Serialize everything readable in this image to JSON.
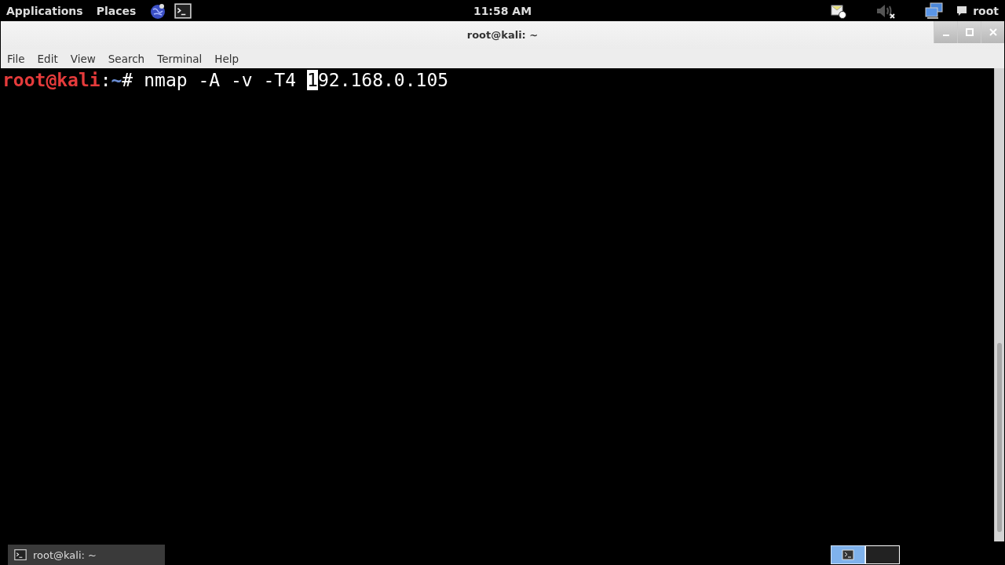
{
  "top_panel": {
    "menus": [
      "Applications",
      "Places"
    ],
    "clock": "11:58 AM",
    "user": "root"
  },
  "window": {
    "title": "root@kali: ~",
    "menu": [
      "File",
      "Edit",
      "View",
      "Search",
      "Terminal",
      "Help"
    ]
  },
  "terminal": {
    "user_host": "root@kali",
    "separator": ":",
    "path": "~",
    "symbol": "#",
    "command": "nmap -A -v -T4",
    "cursor_char": "1",
    "after_cursor": "92.168.0.105"
  },
  "taskbar": {
    "tasks": [
      {
        "label": "root@kali: ~",
        "selected": false
      }
    ],
    "workspaces": [
      {
        "selected": true
      },
      {
        "selected": false
      }
    ]
  }
}
